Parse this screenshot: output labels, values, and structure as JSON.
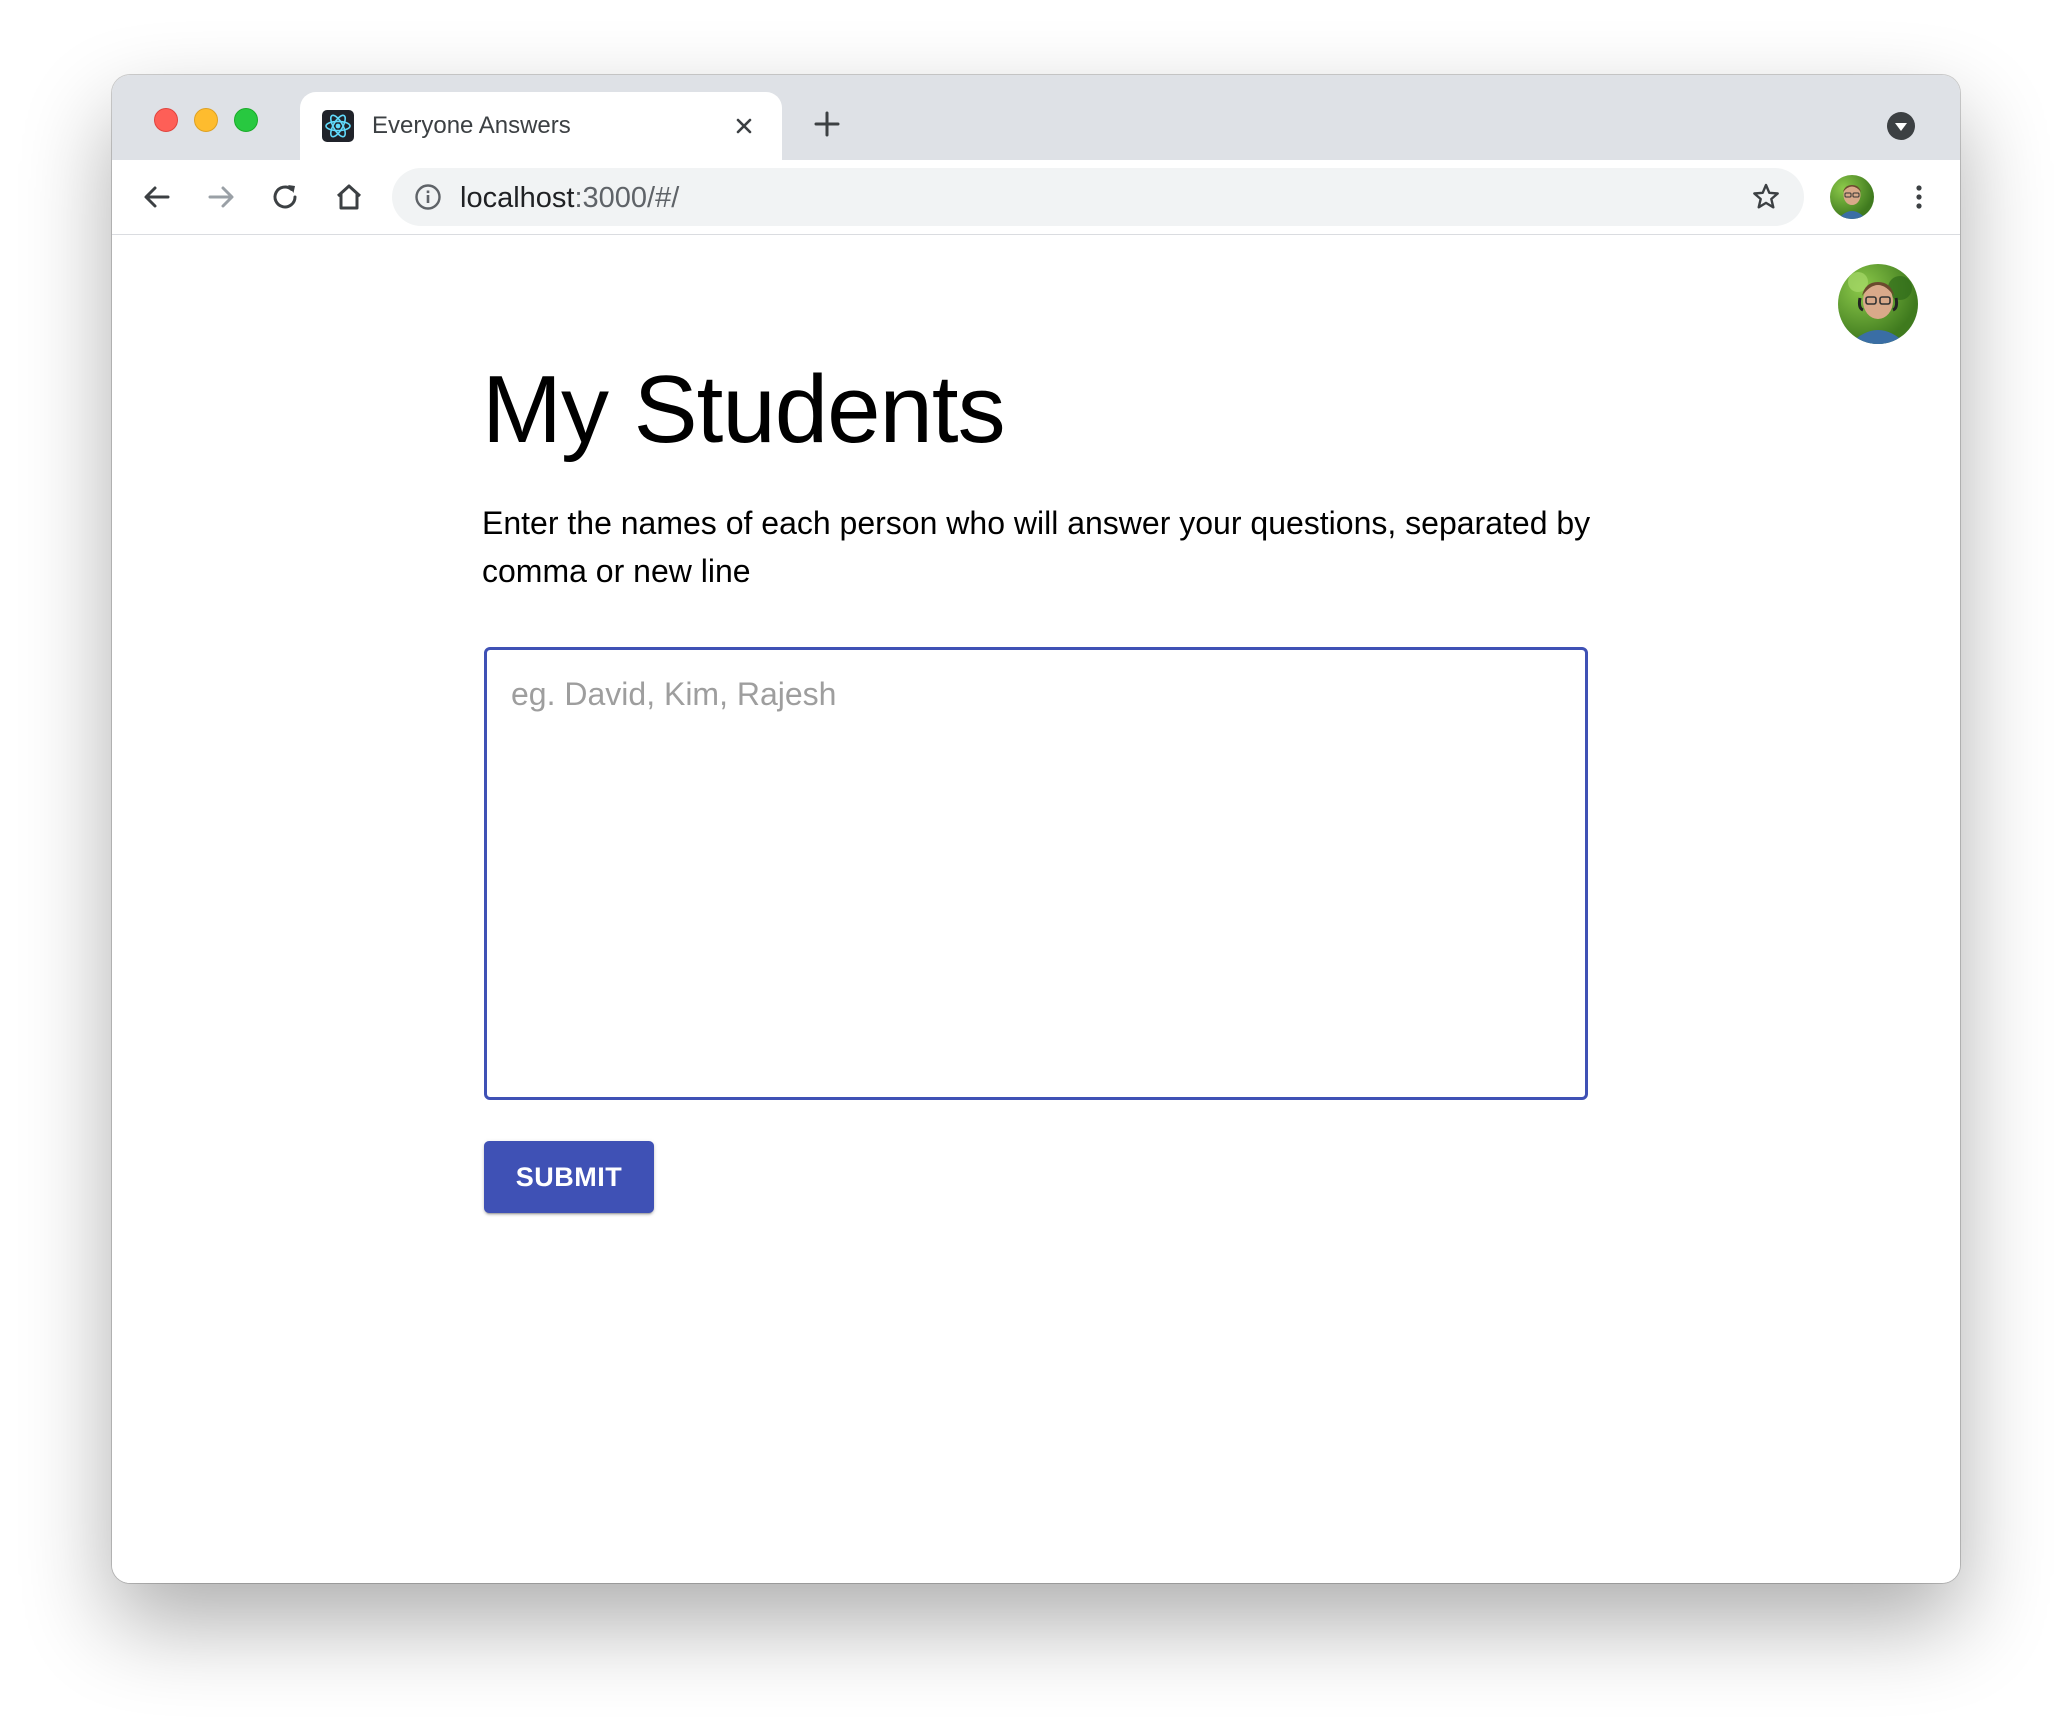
{
  "browser": {
    "tab": {
      "title": "Everyone Answers",
      "favicon": "react-logo-icon"
    },
    "address_bar": {
      "host": "localhost",
      "path": ":3000/#/"
    },
    "icons": {
      "back": "arrow-left-icon",
      "forward": "arrow-right-icon",
      "reload": "reload-icon",
      "home": "home-icon",
      "info": "info-icon",
      "bookmark": "star-icon",
      "menu": "more-vert-icon",
      "tab_close": "close-icon",
      "new_tab": "plus-icon",
      "tab_search": "chevron-down-icon"
    }
  },
  "page": {
    "title": "My Students",
    "instructions": "Enter the names of each person who will answer your questions, separated by comma or new line",
    "names_input": {
      "value": "",
      "placeholder": "eg. David, Kim, Rajesh"
    },
    "submit_label": "SUBMIT"
  },
  "colors": {
    "primary": "#3f51b5",
    "tabstrip": "#dee1e6",
    "omnibox": "#f1f3f4",
    "placeholder": "#9e9e9e"
  }
}
